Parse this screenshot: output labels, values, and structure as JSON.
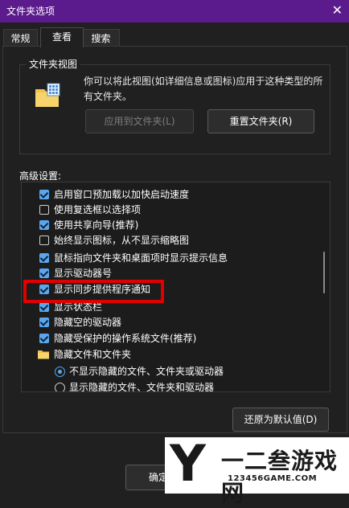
{
  "window": {
    "title": "文件夹选项",
    "close_glyph": "✕"
  },
  "tabs": [
    {
      "label": "常规"
    },
    {
      "label": "查看"
    },
    {
      "label": "搜索"
    }
  ],
  "folder_view": {
    "group_label": "文件夹视图",
    "description": "你可以将此视图(如详细信息或图标)应用于这种类型的所有文件夹。",
    "apply_button": "应用到文件夹(L)",
    "reset_button": "重置文件夹(R)"
  },
  "advanced": {
    "label": "高级设置:",
    "items": [
      {
        "type": "checkbox",
        "checked": true,
        "label": "启用窗口预加载以加快启动速度"
      },
      {
        "type": "checkbox",
        "checked": false,
        "label": "使用复选框以选择项"
      },
      {
        "type": "checkbox",
        "checked": true,
        "label": "使用共享向导(推荐)"
      },
      {
        "type": "checkbox",
        "checked": false,
        "label": "始终显示图标，从不显示缩略图"
      },
      {
        "type": "checkbox",
        "checked": true,
        "label": "鼠标指向文件夹和桌面项时显示提示信息"
      },
      {
        "type": "checkbox",
        "checked": true,
        "label": "显示驱动器号"
      },
      {
        "type": "checkbox",
        "checked": true,
        "label": "显示同步提供程序通知"
      },
      {
        "type": "checkbox",
        "checked": true,
        "label": "显示状态栏"
      },
      {
        "type": "checkbox",
        "checked": true,
        "label": "隐藏空的驱动器"
      },
      {
        "type": "checkbox",
        "checked": true,
        "label": "隐藏受保护的操作系统文件(推荐)"
      },
      {
        "type": "folder",
        "label": "隐藏文件和文件夹"
      },
      {
        "type": "radio",
        "checked": true,
        "label": "不显示隐藏的文件、文件夹或驱动器"
      },
      {
        "type": "radio",
        "checked": false,
        "label": "显示隐藏的文件、文件夹和驱动器"
      }
    ],
    "restore_button": "还原为默认值(D)"
  },
  "footer": {
    "ok_button": "确定"
  },
  "watermark": {
    "logo_letter": "Y",
    "text": "一二叁游戏网",
    "url": "123456GAME.COM"
  },
  "colors": {
    "titlebar": "#5b1b8c",
    "accent": "#5aa7f0",
    "highlight_box": "#e00000"
  }
}
